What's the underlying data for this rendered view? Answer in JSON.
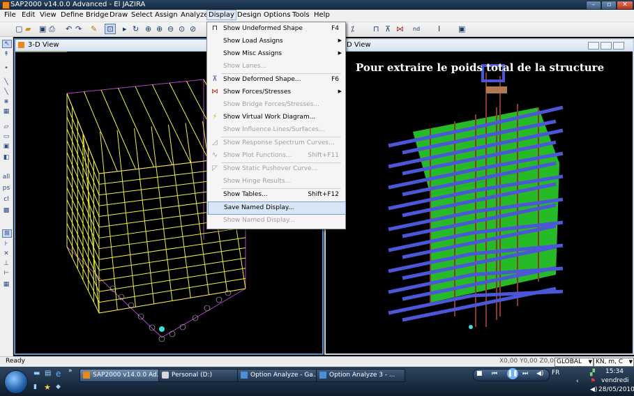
{
  "window": {
    "title": "SAP2000 v14.0.0 Advanced  - El JAZIRA"
  },
  "menubar": {
    "items": [
      "File",
      "Edit",
      "View",
      "Define",
      "Bridge",
      "Draw",
      "Select",
      "Assign",
      "Analyze",
      "Display",
      "Design",
      "Options",
      "Tools",
      "Help"
    ],
    "active": "Display"
  },
  "views": {
    "left_title": "3-D View",
    "right_title": "3-D View",
    "right_title_visible": "D View",
    "overlay_text": "Pour extraire le poids total de la structure"
  },
  "dropdown": {
    "items": [
      {
        "label": "Show Undeformed Shape",
        "shortcut": "F4",
        "enabled": true,
        "icon": "undeformed-shape-icon"
      },
      {
        "label": "Show Load Assigns",
        "submenu": true,
        "enabled": true
      },
      {
        "label": "Show Misc Assigns",
        "submenu": true,
        "enabled": true
      },
      {
        "label": "Show Lanes...",
        "enabled": false
      },
      {
        "label": "Show Deformed Shape...",
        "shortcut": "F6",
        "enabled": true,
        "icon": "deformed-shape-icon"
      },
      {
        "label": "Show Forces/Stresses",
        "submenu": true,
        "enabled": true,
        "icon": "forces-icon"
      },
      {
        "label": "Show Bridge Forces/Stresses...",
        "enabled": false
      },
      {
        "label": "Show Virtual Work Diagram...",
        "enabled": true,
        "icon": "virtual-work-icon"
      },
      {
        "label": "Show Influence Lines/Surfaces...",
        "enabled": false
      },
      {
        "label": "Show Response Spectrum Curves...",
        "enabled": false,
        "icon": "response-spectrum-icon"
      },
      {
        "label": "Show Plot Functions...",
        "shortcut": "Shift+F11",
        "enabled": false,
        "icon": "plot-functions-icon"
      },
      {
        "label": "Show Static Pushover Curve...",
        "enabled": false,
        "icon": "pushover-icon"
      },
      {
        "label": "Show Hinge Results...",
        "enabled": false
      },
      {
        "label": "Show Tables...",
        "shortcut": "Shift+F12",
        "enabled": true
      },
      {
        "label": "Save Named Display...",
        "enabled": true,
        "highlighted": true
      },
      {
        "label": "Show Named Display...",
        "enabled": false
      }
    ]
  },
  "statusbar": {
    "status": "Ready",
    "coords": "X0,00  Y0,00  Z0,00",
    "coord_system": "GLOBAL",
    "units": "KN, m, C"
  },
  "taskbar": {
    "tasks": [
      "SAP2000 v14.0.0 Ad...",
      "Personal (D:)",
      "Option Analyze - Ga...",
      "Option Analyze 3 - ..."
    ],
    "language": "FR",
    "time": "15:34",
    "day": "vendredi",
    "date": "28/05/2010"
  },
  "colors": {
    "frame_yellow": "#f2f23a",
    "frame_magenta": "#b043c8",
    "beam_blue": "#4b57d6",
    "wall_green": "#2ddc2d",
    "column_brown": "#8b3a2a"
  }
}
